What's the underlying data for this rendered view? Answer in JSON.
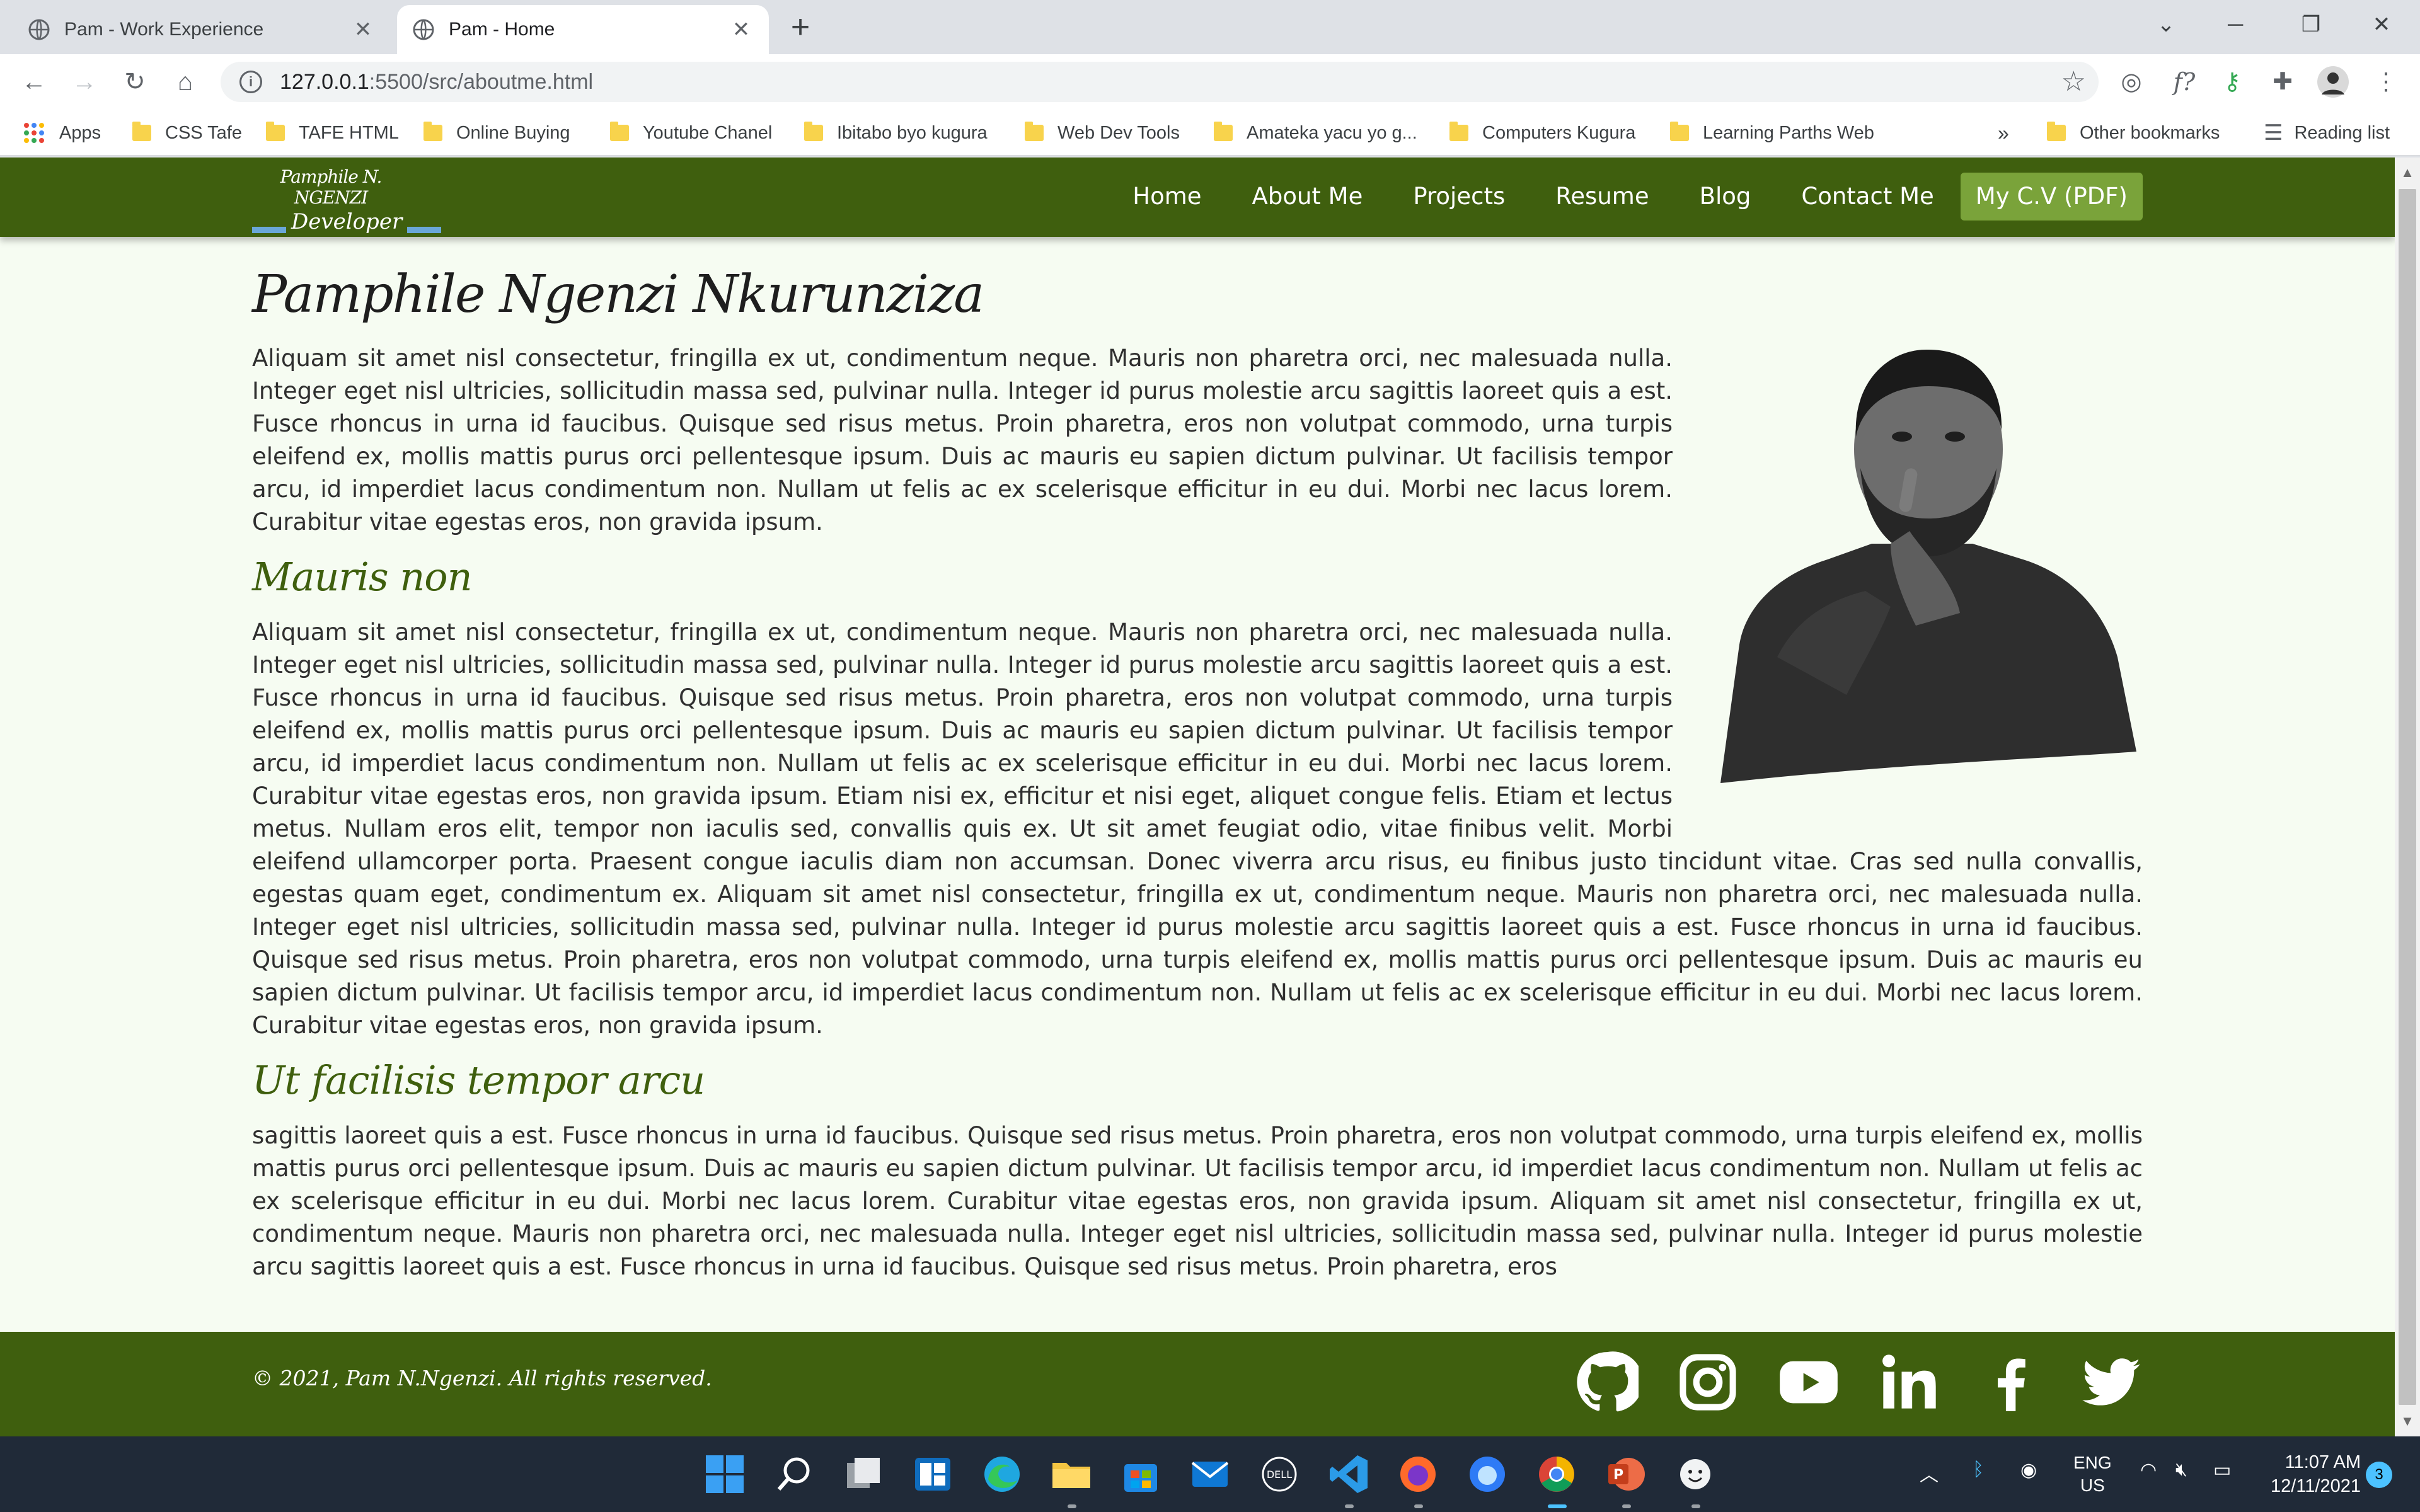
{
  "browser": {
    "tabs": [
      {
        "title": "Pam - Work Experience",
        "active": false
      },
      {
        "title": "Pam - Home",
        "active": true
      }
    ],
    "new_tab_label": "+",
    "address": {
      "host": "127.0.0.1",
      "path": ":5500/src/aboutme.html"
    },
    "bookmarks": [
      "Apps",
      "CSS Tafe",
      "TAFE HTML",
      "Online  Buying",
      "Youtube Chanel",
      "Ibitabo byo kugura",
      "Web Dev Tools",
      "Amateka yacu yo g...",
      "Computers Kugura",
      "Learning Parths Web"
    ],
    "bookmarks_overflow": "»",
    "other_bookmarks": "Other bookmarks",
    "reading_list": "Reading list"
  },
  "site": {
    "logo": {
      "name": "Pamphile N. NGENZI",
      "role": "Developer"
    },
    "nav": [
      "Home",
      "About Me",
      "Projects",
      "Resume",
      "Blog",
      "Contact Me"
    ],
    "cv_button": "My C.V (PDF)",
    "heading": "Pamphile Ngenzi Nkurunziza",
    "intro": "Aliquam sit amet nisl consectetur, fringilla ex ut, condimentum neque. Mauris non pharetra orci, nec malesuada nulla. Integer eget nisl ultricies, sollicitudin massa sed, pulvinar nulla. Integer id purus molestie arcu sagittis laoreet quis a est. Fusce rhoncus in urna id faucibus. Quisque sed risus metus. Proin pharetra, eros non volutpat commodo, urna turpis eleifend ex, mollis mattis purus orci pellentesque ipsum. Duis ac mauris eu sapien dictum pulvinar. Ut facilisis tempor arcu, id imperdiet lacus condimentum non. Nullam ut felis ac ex scelerisque efficitur in eu dui. Morbi nec lacus lorem. Curabitur vitae egestas eros, non gravida ipsum.",
    "section1_title": "Mauris non",
    "section1_text": "Aliquam sit amet nisl consectetur, fringilla ex ut, condimentum neque. Mauris non pharetra orci, nec malesuada nulla. Integer eget nisl ultricies, sollicitudin massa sed, pulvinar nulla. Integer id purus molestie arcu sagittis laoreet quis a est. Fusce rhoncus in urna id faucibus. Quisque sed risus metus. Proin pharetra, eros non volutpat commodo, urna turpis eleifend ex, mollis mattis purus orci pellentesque ipsum. Duis ac mauris eu sapien dictum pulvinar. Ut facilisis tempor arcu, id imperdiet lacus condimentum non. Nullam ut felis ac ex scelerisque efficitur in eu dui. Morbi nec lacus lorem. Curabitur vitae egestas eros, non gravida ipsum. Etiam nisi ex, efficitur et nisi eget, aliquet congue felis. Etiam et lectus metus. Nullam eros elit, tempor non iaculis sed, convallis quis ex. Ut sit amet feugiat odio, vitae finibus velit. Morbi eleifend ullamcorper porta. Praesent congue iaculis diam non accumsan. Donec viverra arcu risus, eu finibus justo tincidunt vitae. Cras sed nulla convallis, egestas quam eget, condimentum ex. Aliquam sit amet nisl consectetur, fringilla ex ut, condimentum neque. Mauris non pharetra orci, nec malesuada nulla. Integer eget nisl ultricies, sollicitudin massa sed, pulvinar nulla. Integer id purus molestie arcu sagittis laoreet quis a est. Fusce rhoncus in urna id faucibus. Quisque sed risus metus. Proin pharetra, eros non volutpat commodo, urna turpis eleifend ex, mollis mattis purus orci pellentesque ipsum. Duis ac mauris eu sapien dictum pulvinar. Ut facilisis tempor arcu, id imperdiet lacus condimentum non. Nullam ut felis ac ex scelerisque efficitur in eu dui. Morbi nec lacus lorem. Curabitur vitae egestas eros, non gravida ipsum.",
    "section2_title": "Ut facilisis tempor arcu",
    "section2_text": "sagittis laoreet quis a est. Fusce rhoncus in urna id faucibus. Quisque sed risus metus. Proin pharetra, eros non volutpat commodo, urna turpis eleifend ex, mollis mattis purus orci pellentesque ipsum. Duis ac mauris eu sapien dictum pulvinar. Ut facilisis tempor arcu, id imperdiet lacus condimentum non. Nullam ut felis ac ex scelerisque efficitur in eu dui. Morbi nec lacus lorem. Curabitur vitae egestas eros, non gravida ipsum. Aliquam sit amet nisl consectetur, fringilla ex ut, condimentum neque. Mauris non pharetra orci, nec malesuada nulla. Integer eget nisl ultricies, sollicitudin massa sed, pulvinar nulla. Integer id purus molestie arcu sagittis laoreet quis a est. Fusce rhoncus in urna id faucibus. Quisque sed risus metus. Proin pharetra, eros",
    "footer_copyright": "© 2021, Pam N.Ngenzi. All rights reserved.",
    "socials": [
      "github-icon",
      "instagram-icon",
      "youtube-icon",
      "linkedin-icon",
      "facebook-icon",
      "twitter-icon"
    ],
    "colors": {
      "nav_bg": "#3f5f0e",
      "cv_button": "#7aa33a",
      "page_bg": "#f6fcf2",
      "heading_accent": "#3f5f0e"
    }
  },
  "taskbar": {
    "language": {
      "line1": "ENG",
      "line2": "US"
    },
    "time": "11:07 AM",
    "date": "12/11/2021",
    "notifications": "3"
  }
}
